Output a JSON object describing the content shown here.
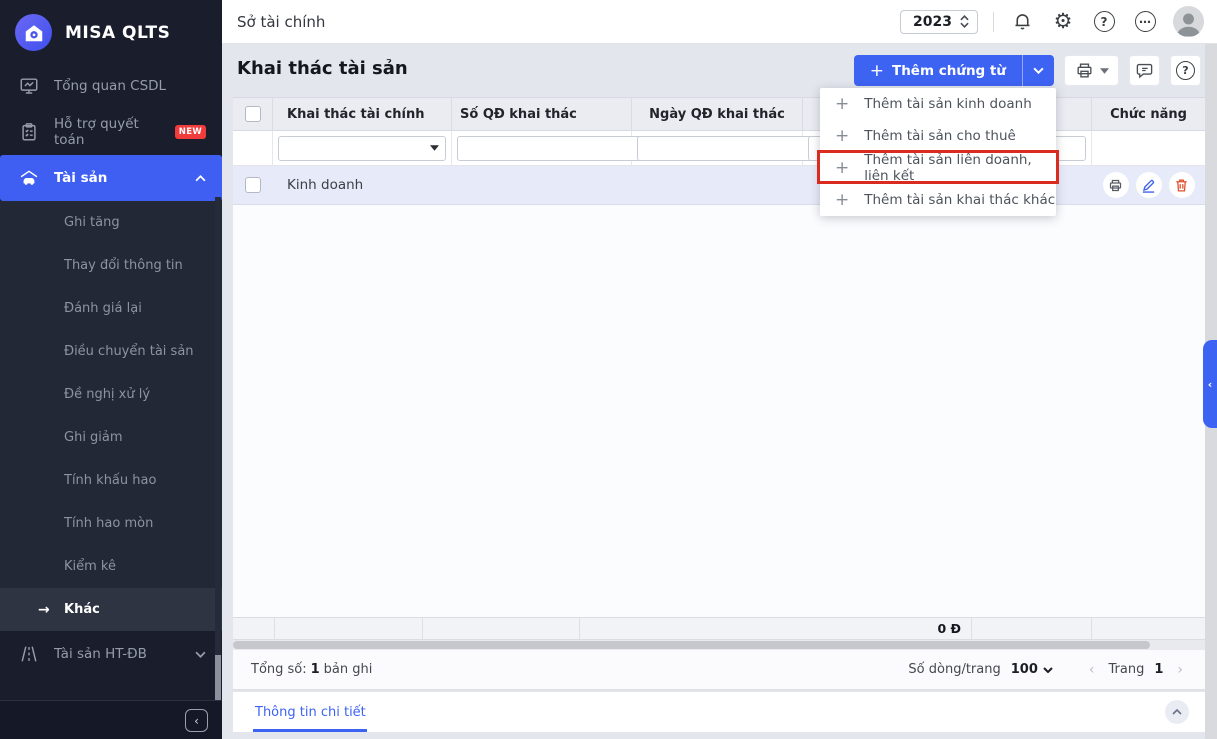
{
  "app": {
    "brand": "MISA QLTS"
  },
  "colors": {
    "accent_blue": "#3d63f3",
    "sidebar_bg": "#1a1e2c",
    "annotation_red": "#d92b20",
    "badge_red": "#f23c3c",
    "edit_blue": "#4263eb",
    "delete_red": "#e4502e",
    "row_selected": "#e7eaf8"
  },
  "icons": {
    "plus": "+",
    "gear": "⚙",
    "help": "?",
    "more": "⋯",
    "arrow_right": "→",
    "chevron_left": "‹",
    "prev": "‹",
    "next": "›"
  },
  "sidebar": {
    "items": [
      {
        "label": "Tổng quan CSDL",
        "icon": "dashboard-icon"
      },
      {
        "label": "Hỗ trợ quyết toán",
        "icon": "clipboard-icon",
        "badge": "NEW"
      },
      {
        "label": "Tài sản",
        "icon": "asset-icon",
        "active": true
      },
      {
        "label": "Tài sản HT-ĐB",
        "icon": "road-icon"
      }
    ],
    "submenu": [
      "Ghi tăng",
      "Thay đổi thông tin",
      "Đánh giá lại",
      "Điều chuyển tài sản",
      "Đề nghị xử lý",
      "Ghi giảm",
      "Tính khấu hao",
      "Tính hao mòn",
      "Kiểm kê",
      "Khác"
    ],
    "submenu_active": "Khác"
  },
  "topbar": {
    "org": "Sở tài chính",
    "year": "2023"
  },
  "page": {
    "title": "Khai thác tài sản",
    "add_button": "Thêm chứng từ"
  },
  "add_menu": {
    "items": [
      "Thêm tài sản kinh doanh",
      "Thêm tài sản cho thuê",
      "Thêm tài sản liên doanh, liên kết",
      "Thêm tài sản khai thác khác"
    ],
    "highlighted_item": "Thêm tài sản liên doanh, liên kết"
  },
  "table": {
    "columns": [
      "Khai thác tài chính",
      "Số QĐ khai thác",
      "Ngày QĐ khai thác",
      "Chức năng"
    ],
    "rows": [
      {
        "khai_thac": "Kinh doanh"
      }
    ],
    "summary_total": "0 Đ"
  },
  "statusbar": {
    "total_label": "Tổng số:",
    "total_count": "1",
    "total_suffix": "bản ghi",
    "rows_per_page_label": "Số dòng/trang",
    "rows_per_page": "100",
    "page_label": "Trang",
    "page_number": "1"
  },
  "detail_panel": {
    "tab": "Thông tin chi tiết"
  }
}
